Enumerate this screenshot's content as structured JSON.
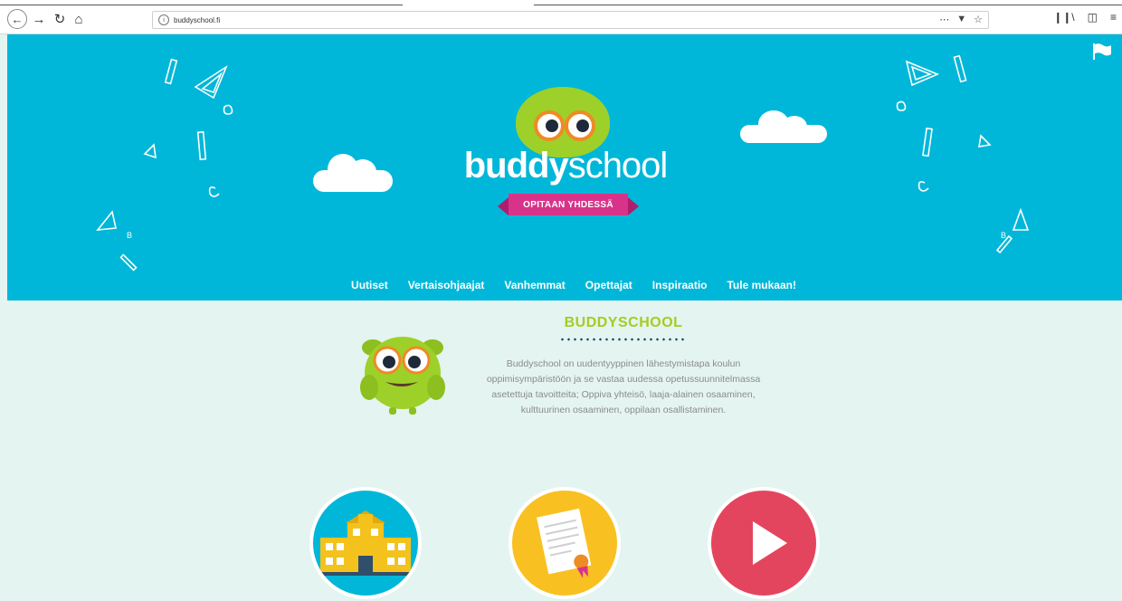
{
  "browser": {
    "url": "buddyschool.fi",
    "icons": [
      "back-icon",
      "forward-icon",
      "reload-icon",
      "home-icon",
      "info-icon",
      "more-icon",
      "pocket-icon",
      "star-icon",
      "library-icon",
      "sidebar-icon",
      "menu-icon"
    ]
  },
  "hero": {
    "logo_bold": "buddy",
    "logo_light": "school",
    "tagline": "OPITAAN YHDESSÄ",
    "colors": {
      "background": "#00b7d9",
      "owl": "#9ed02a",
      "ribbon": "#d8338a"
    }
  },
  "nav": {
    "items": [
      "Uutiset",
      "Vertaisohjaajat",
      "Vanhemmat",
      "Opettajat",
      "Inspiraatio",
      "Tule mukaan!"
    ]
  },
  "intro": {
    "title": "BUDDYSCHOOL",
    "text": "Buddyschool on uudentyyppinen lähestymistapa koulun oppimisympäristöön ja se vastaa uudessa opetussuunnitelmassa asetettuja tavoitteita; Oppiva yhteisö, laaja-alainen osaaminen, kulttuurinen osaaminen, oppilaan osallistaminen.",
    "colors": {
      "title": "#a5cc1f",
      "text": "#8b8b8b"
    }
  },
  "features": [
    {
      "icon": "school-building-icon",
      "color": "#00b7d9"
    },
    {
      "icon": "certificate-icon",
      "color": "#f9c021"
    },
    {
      "icon": "play-icon",
      "color": "#e4455e"
    }
  ]
}
